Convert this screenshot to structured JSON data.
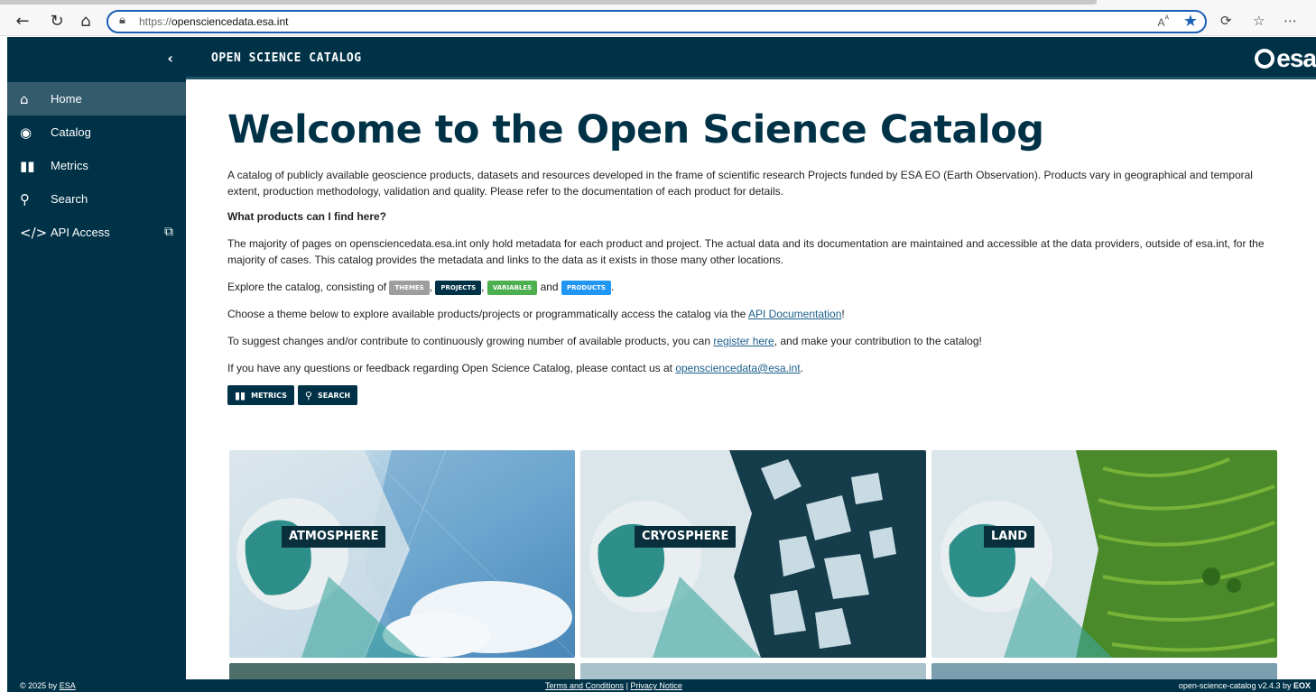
{
  "browser": {
    "url_prefix": "https://",
    "url_domain": "opensciencedata.esa.int",
    "back_icon": "arrow-left-icon",
    "reload_icon": "reload-icon",
    "home_icon": "home-icon"
  },
  "sidebar": {
    "collapse_icon": "chevron-left-icon",
    "items": [
      {
        "label": "Home",
        "icon": "home-icon",
        "active": true
      },
      {
        "label": "Catalog",
        "icon": "compass-icon"
      },
      {
        "label": "Metrics",
        "icon": "bar-chart-icon"
      },
      {
        "label": "Search",
        "icon": "search-icon"
      },
      {
        "label": "API Access",
        "icon": "code-icon",
        "external": true
      }
    ]
  },
  "header": {
    "title": "OPEN SCIENCE CATALOG",
    "logo": "esa"
  },
  "main": {
    "heading": "Welcome to the Open Science Catalog",
    "intro": "A catalog of publicly available geoscience products, datasets and resources developed in the frame of scientific research Projects funded by ESA EO (Earth Observation). Products vary in geographical and temporal extent, production methodology, validation and quality. Please refer to the documentation of each product for details.",
    "question": "What products can I find here?",
    "majority": "The majority of pages on opensciencedata.esa.int only hold metadata for each product and project. The actual data and its documentation are maintained and accessible at the data providers, outside of esa.int, for the majority of cases. This catalog provides the metadata and links to the data as it exists in those many other locations.",
    "explore_prefix": "Explore the catalog, consisting of",
    "chips": {
      "themes": "THEMES",
      "projects": "PROJECTS",
      "variables": "VARIABLES",
      "products": "PRODUCTS"
    },
    "and": "and",
    "choose_prefix": "Choose a theme below to explore available products/projects or programmatically access the catalog via the",
    "choose_link": "API Documentation",
    "choose_suffix": "!",
    "suggest_prefix": "To suggest changes and/or contribute to continuously growing number of available products, you can",
    "suggest_link": "register here",
    "suggest_suffix": ", and make your contribution to the catalog!",
    "questions_prefix": "If you have any questions or feedback regarding Open Science Catalog, please contact us at",
    "questions_link": "opensciencedata@esa.int",
    "questions_suffix": ".",
    "buttons": {
      "metrics": "METRICS",
      "search": "SEARCH"
    }
  },
  "themes": [
    {
      "label": "ATMOSPHERE",
      "color": "#6aa3c8"
    },
    {
      "label": "CRYOSPHERE",
      "color": "#143c4a"
    },
    {
      "label": "LAND",
      "color": "#4a8a2a"
    }
  ],
  "footer": {
    "copyright_prefix": "© 2025 by",
    "copyright_link": "ESA",
    "terms": "Terms and Conditions",
    "sep": "|",
    "privacy": "Privacy Notice",
    "version": "open-science-catalog v2.4.3 by"
  }
}
